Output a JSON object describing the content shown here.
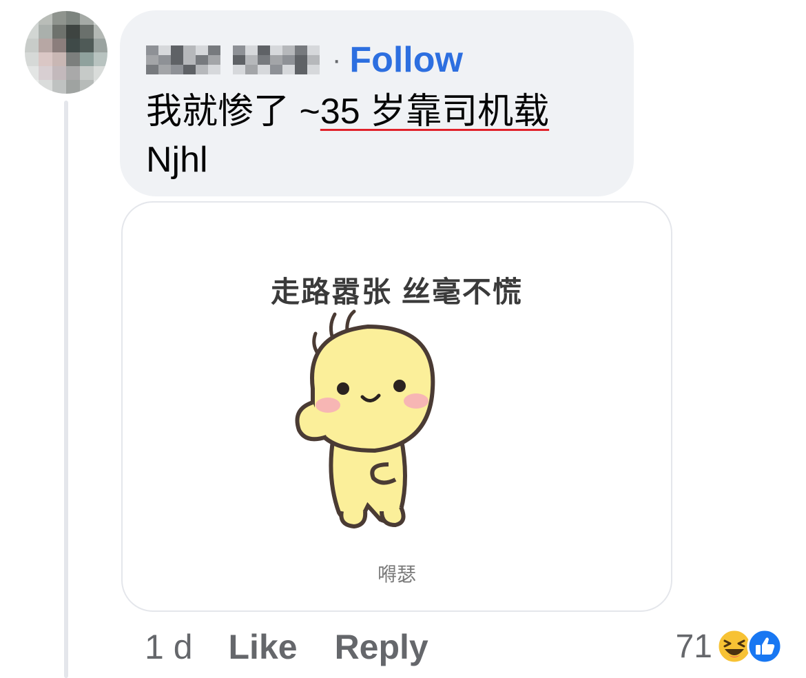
{
  "comment": {
    "author_name": "",
    "follow_label": "Follow",
    "separator": "·",
    "text_before_underline": "我就惨了 ~",
    "text_underlined": "35 岁靠司机载",
    "text_line2": "Njhl"
  },
  "sticker": {
    "caption": "走路嚣张 丝毫不慌",
    "watermark": "嘚瑟"
  },
  "actions": {
    "time": "1 d",
    "like_label": "Like",
    "reply_label": "Reply"
  },
  "reactions": {
    "count": "71",
    "icons": [
      "laugh-reaction-icon",
      "like-reaction-icon"
    ]
  },
  "colors": {
    "follow": "#2d6fe0",
    "bubble_bg": "#f0f2f5",
    "like_blue": "#1877f2",
    "underline_red": "#e0212a"
  }
}
